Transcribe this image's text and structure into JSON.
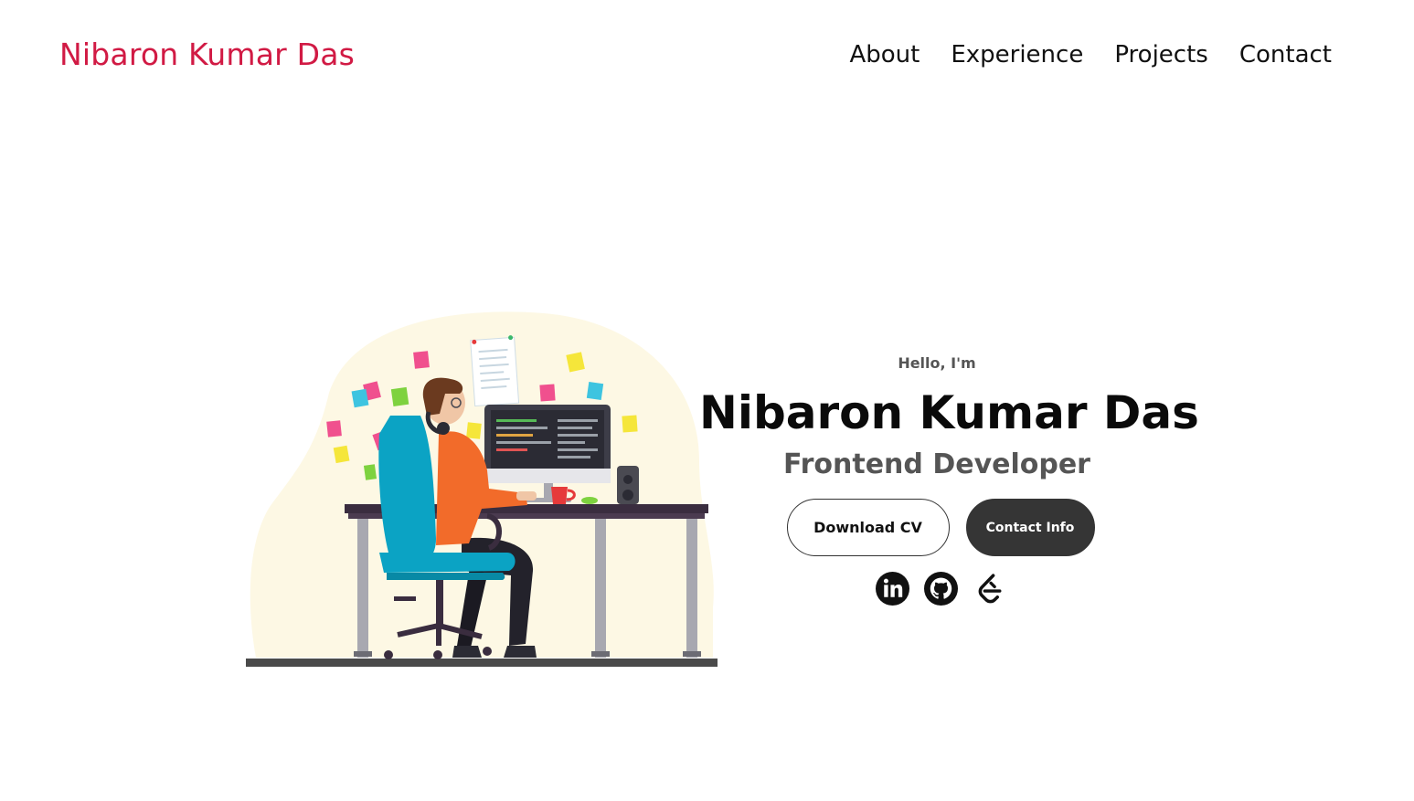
{
  "nav": {
    "logo": "Nibaron Kumar Das",
    "links": [
      "About",
      "Experience",
      "Projects",
      "Contact"
    ]
  },
  "hero": {
    "greeting": "Hello, I'm",
    "name": "Nibaron Kumar Das",
    "role": "Frontend Developer",
    "buttons": {
      "download": "Download CV",
      "contact": "Contact Info"
    },
    "socials": [
      "linkedin-icon",
      "github-icon",
      "leetcode-icon"
    ]
  },
  "colors": {
    "brand": "#d11a44",
    "dark_button": "#353535",
    "text_muted": "#555555"
  }
}
